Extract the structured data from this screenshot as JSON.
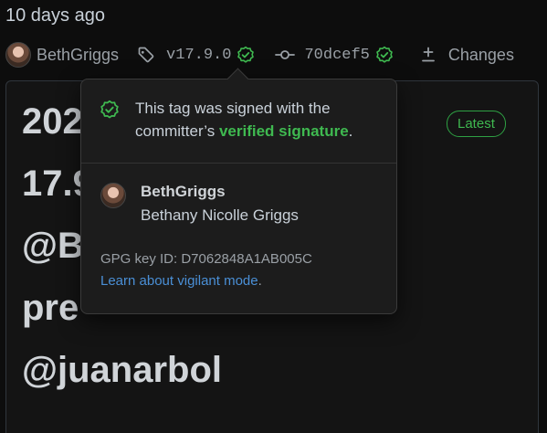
{
  "header": {
    "time_ago": "10 days ago",
    "author": "BethGriggs",
    "tag": "v17.9.0",
    "commit": "70dcef5",
    "changes_label": "Changes"
  },
  "release": {
    "title_lines": "202\n17.9\n@B\npre\n@juanarbol",
    "latest_badge": "Latest"
  },
  "popover": {
    "message_prefix": "This tag was signed with the committer’s ",
    "message_strong": "verified signature",
    "message_suffix": ".",
    "login": "BethGriggs",
    "full_name": "Bethany Nicolle Griggs",
    "gpg_key": "GPG key ID: D7062848A1AB005C",
    "learn_link": "Learn about vigilant mode",
    "learn_suffix": "."
  },
  "colors": {
    "verified_green": "#3fb950",
    "link_blue": "#4a8fd6",
    "background": "#0d0d0d"
  },
  "icons": [
    "tag-icon",
    "verified-check-icon",
    "commit-icon",
    "diff-icon"
  ]
}
